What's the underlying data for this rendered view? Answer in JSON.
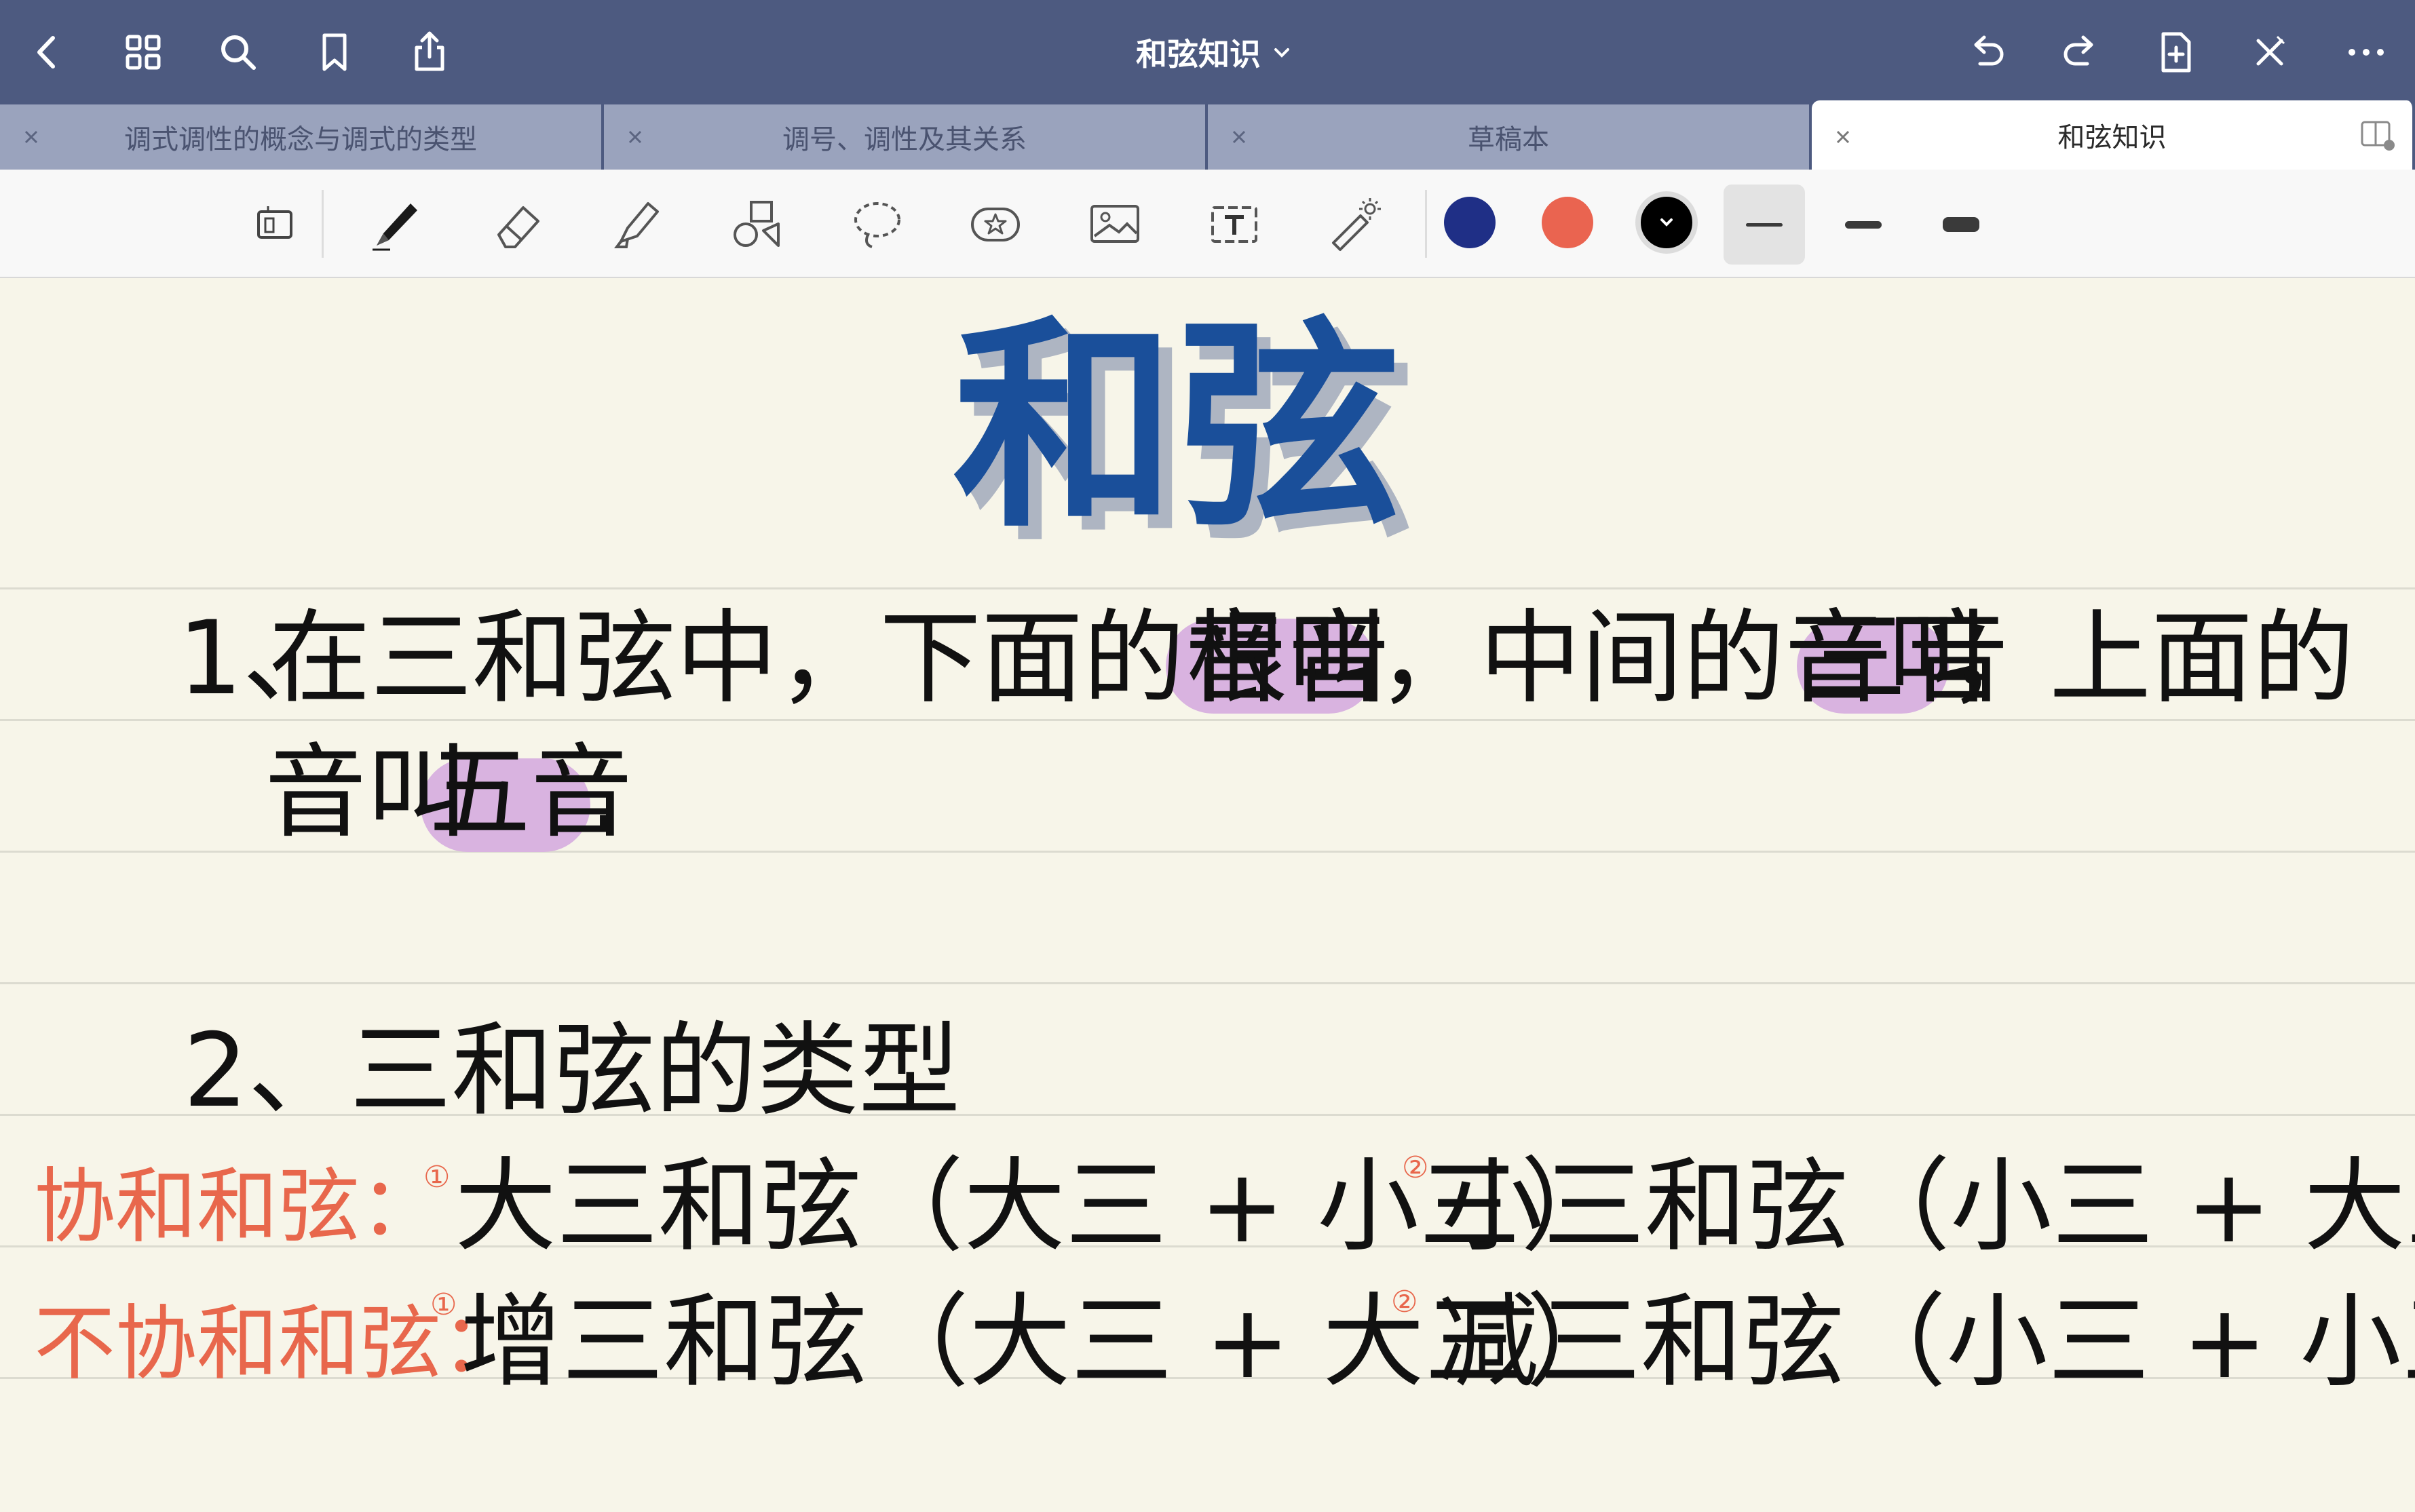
{
  "app": {
    "document_title": "和弦知识"
  },
  "tabs": [
    {
      "label": "调式调性的概念与调式的类型",
      "active": false
    },
    {
      "label": "调号、调性及其关系",
      "active": false
    },
    {
      "label": "草稿本",
      "active": false
    },
    {
      "label": "和弦知识",
      "active": true
    }
  ],
  "toolbar": {
    "tools": [
      "read-mode",
      "pen",
      "eraser",
      "highlighter",
      "shapes",
      "lasso",
      "sticker",
      "image",
      "text",
      "laser-pointer"
    ],
    "selected_tool": "pen",
    "colors": [
      "#1f2f86",
      "#ea6450",
      "#000000"
    ],
    "selected_color": "#000000",
    "stroke_widths": [
      "thin",
      "medium",
      "thick"
    ],
    "selected_stroke": "thin"
  },
  "highlight_color": "#d9b3e0",
  "note": {
    "title": "和弦",
    "section1": {
      "number": "1、",
      "parts": [
        "在三和弦中，下面的音叫",
        "根音",
        "，中间的音叫",
        "三音",
        "，上面的"
      ],
      "line2_parts": [
        "音叫",
        "五音",
        "."
      ]
    },
    "section2": {
      "heading": "2、三和弦的类型",
      "rows": [
        {
          "category": "协和和弦：",
          "items": [
            {
              "mark": "①",
              "text": "大三和弦（大三 + 小三）"
            },
            {
              "mark": "②",
              "text": "小三和弦（小三 + 大三）"
            }
          ]
        },
        {
          "category": "不协和和弦：",
          "items": [
            {
              "mark": "①",
              "text": "增三和弦（大三 + 大三）"
            },
            {
              "mark": "②",
              "text": "减三和弦（小三 + 小三）"
            }
          ]
        }
      ]
    }
  }
}
